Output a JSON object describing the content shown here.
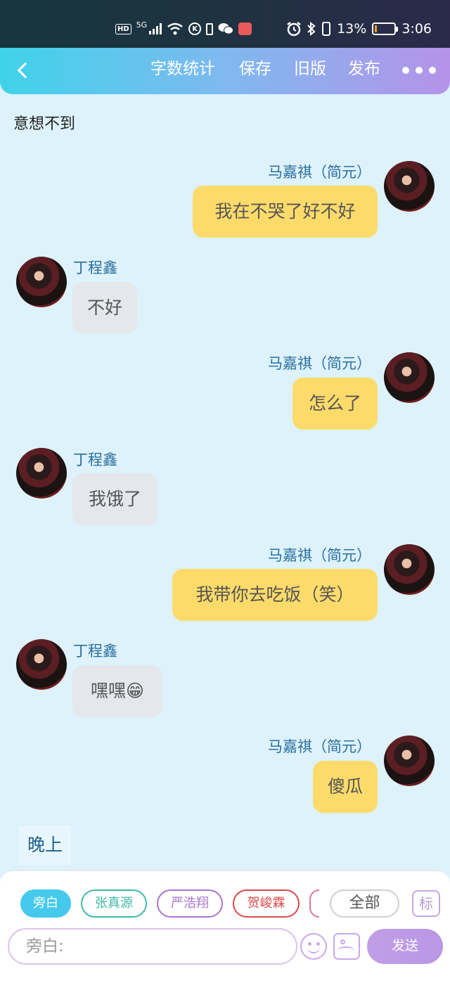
{
  "status_bar": {
    "network": "5G",
    "hd": "HD",
    "k_icon": "K",
    "battery_percent": "13%",
    "battery_level": 0.13,
    "time": "3:06",
    "icons": [
      "hd-icon",
      "signal-icon",
      "wifi-icon",
      "k-icon",
      "phone-battery-icon",
      "wechat-icon",
      "app-icon",
      "alarm-icon",
      "bluetooth-icon",
      "vibrate-icon",
      "battery-icon"
    ]
  },
  "header": {
    "back_icon": "back-chevron-icon",
    "buttons": [
      "字数统计",
      "保存",
      "旧版",
      "发布"
    ],
    "more_icon": "more-dots-icon"
  },
  "chat": {
    "narration_top": "意想不到",
    "messages": [
      {
        "side": "right",
        "name": "马嘉祺（简元）",
        "text": "我在不哭了好不好"
      },
      {
        "side": "left",
        "name": "丁程鑫",
        "text": "不好"
      },
      {
        "side": "right",
        "name": "马嘉祺（简元）",
        "text": "怎么了"
      },
      {
        "side": "left",
        "name": "丁程鑫",
        "text": "我饿了"
      },
      {
        "side": "right",
        "name": "马嘉祺（简元）",
        "text": "我带你去吃饭（笑）"
      },
      {
        "side": "left",
        "name": "丁程鑫",
        "text": "嘿嘿😁"
      },
      {
        "side": "right",
        "name": "马嘉祺（简元）",
        "text": "傻瓜"
      }
    ],
    "narration_bottom": "晚上"
  },
  "composer": {
    "chips": [
      {
        "label": "旁白",
        "color": "#45c9ec",
        "active": true
      },
      {
        "label": "张真源",
        "color": "#3fb9a8",
        "active": false
      },
      {
        "label": "严浩翔",
        "color": "#a974cf",
        "active": false
      },
      {
        "label": "贺峻霖",
        "color": "#d94a4a",
        "active": false
      }
    ],
    "all_label": "全部",
    "mark_label": "标",
    "input_placeholder": "旁白:",
    "send_label": "发送",
    "emoji_icon": "emoji-icon",
    "image_icon": "image-icon"
  }
}
